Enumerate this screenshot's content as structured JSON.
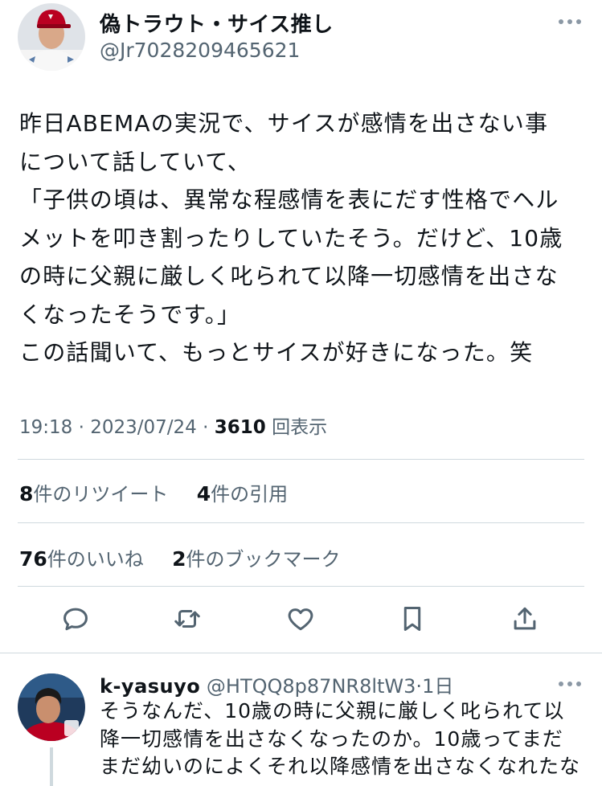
{
  "tweet": {
    "author_name": "偽トラウト・サイス推し",
    "author_handle": "@Jr7028209465621",
    "lines": [
      "昨日ABEMAの実況で、サイスが感情を出さない事",
      "について話していて、",
      "「子供の頃は、異常な程感情を表にだす性格でヘル",
      "メットを叩き割ったりしていたそう。だけど、10歳",
      "の時に父親に厳しく叱られて以降一切感情を出さな",
      "くなったそうです。」",
      "この話聞いて、もっとサイスが好きになった。笑"
    ],
    "time": "19:18",
    "date": "2023/07/24",
    "views_count": "3610",
    "views_label": "回表示"
  },
  "stats": {
    "retweets_count": "8",
    "retweets_label": "件のリツイート",
    "quotes_count": "4",
    "quotes_label": "件の引用",
    "likes_count": "76",
    "likes_label": "件のいいね",
    "bookmarks_count": "2",
    "bookmarks_label": "件のブックマーク"
  },
  "actions": [
    "reply-icon",
    "retweet-icon",
    "like-icon",
    "bookmark-icon",
    "share-icon"
  ],
  "reply": {
    "author_name": "k-yasuyo",
    "author_handle": "@HTQQ8p87NR8ltW3",
    "time_ago": "1日",
    "lines": [
      "そうなんだ、10歳の時に父親に厳しく叱られて以",
      "降一切感情を出さなくなったのか。10歳ってまだ",
      "まだ幼いのによくそれ以降感情を出さなくなれたな"
    ]
  },
  "colors": {
    "text": "#0f1419",
    "secondary": "#536471",
    "divider": "#cfd9de",
    "angels_red": "#ba0021"
  }
}
